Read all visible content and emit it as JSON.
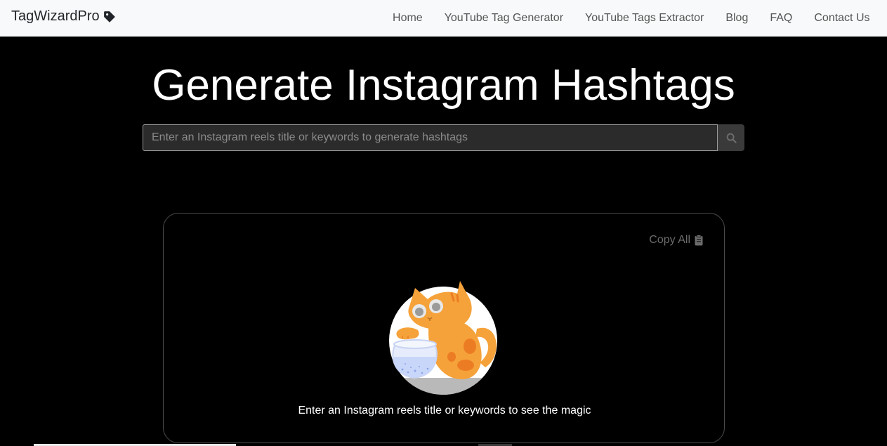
{
  "navbar": {
    "brand": "TagWizardPro",
    "brand_icon": "tag-icon",
    "links": [
      {
        "label": "Home"
      },
      {
        "label": "YouTube Tag Generator"
      },
      {
        "label": "YouTube Tags Extractor"
      },
      {
        "label": "Blog"
      },
      {
        "label": "FAQ"
      },
      {
        "label": "Contact Us"
      }
    ]
  },
  "hero": {
    "title": "Generate Instagram Hashtags"
  },
  "search": {
    "value": "",
    "placeholder": "Enter an Instagram reels title or keywords to generate hashtags",
    "button_icon": "search-icon"
  },
  "results": {
    "copy_all_label": "Copy All",
    "copy_icon": "clipboard-icon",
    "illustration": "cat-fishbowl-illustration",
    "empty_message": "Enter an Instagram reels title or keywords to see the magic"
  },
  "colors": {
    "navbar_bg": "#f8f9fa",
    "page_bg": "#000000",
    "cat_orange": "#f5a23a"
  }
}
